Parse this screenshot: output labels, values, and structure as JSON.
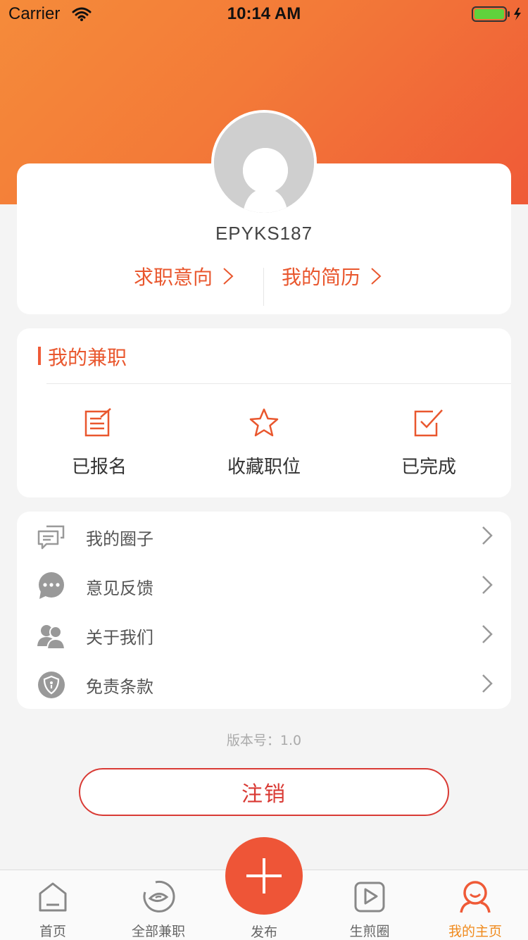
{
  "status_bar": {
    "carrier": "Carrier",
    "time": "10:14 AM"
  },
  "profile": {
    "username": "EPYKS187",
    "job_intention_label": "求职意向",
    "resume_label": "我的简历"
  },
  "my_jobs": {
    "title": "我的兼职",
    "items": [
      {
        "label": "已报名",
        "icon": "signup-list-icon"
      },
      {
        "label": "收藏职位",
        "icon": "star-icon"
      },
      {
        "label": "已完成",
        "icon": "checked-box-icon"
      }
    ]
  },
  "menu": {
    "items": [
      {
        "label": "我的圈子",
        "icon": "chat-bubbles-icon"
      },
      {
        "label": "意见反馈",
        "icon": "speech-bubble-icon"
      },
      {
        "label": "关于我们",
        "icon": "users-icon"
      },
      {
        "label": "免责条款",
        "icon": "shield-icon"
      }
    ]
  },
  "version_text": "版本号：1.0",
  "logout_label": "注销",
  "tabbar": {
    "items": [
      {
        "label": "首页",
        "icon": "home-icon"
      },
      {
        "label": "全部兼职",
        "icon": "eye-circle-icon"
      },
      {
        "label": "发布",
        "icon": "plus-icon"
      },
      {
        "label": "生煎圈",
        "icon": "play-icon"
      },
      {
        "label": "我的主页",
        "icon": "profile-icon"
      }
    ],
    "active": "我的主页"
  },
  "colors": {
    "accent": "#e9572e",
    "header_start": "#f58b3a",
    "header_end": "#ef5a37",
    "logout": "#d93a34",
    "tab_active": "#f08a1c"
  }
}
